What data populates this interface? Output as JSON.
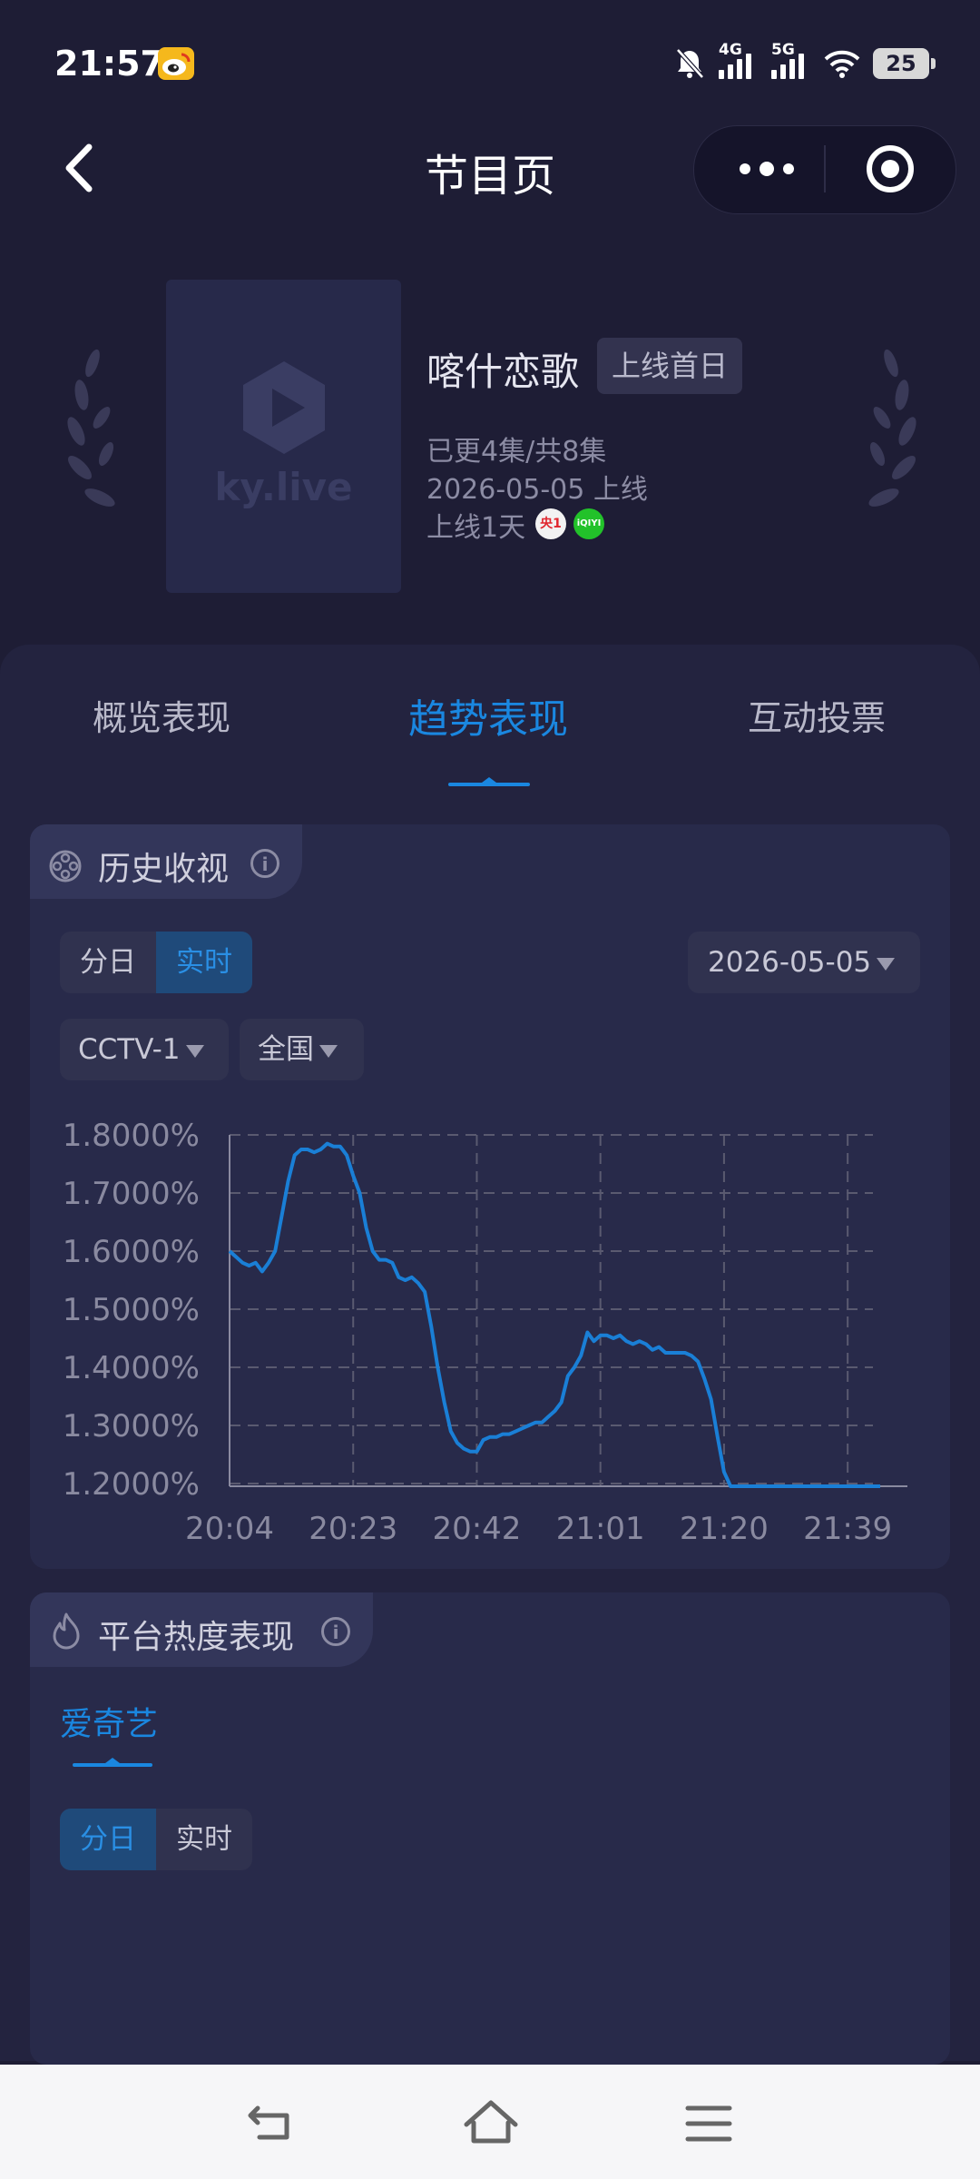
{
  "status_bar": {
    "time": "21:57",
    "battery": "25",
    "network_1": "4G",
    "network_2": "5G"
  },
  "header": {
    "title": "节目页"
  },
  "show": {
    "logo_text": "ky.live",
    "title": "喀什恋歌",
    "badge": "上线首日",
    "episodes": "已更4集/共8集",
    "release": "2026-05-05 上线",
    "days_online": "上线1天",
    "platform_badges": [
      "央1",
      "iQIYI"
    ]
  },
  "tabs": [
    {
      "label": "概览表现",
      "active": false
    },
    {
      "label": "趋势表现",
      "active": true
    },
    {
      "label": "互动投票",
      "active": false
    }
  ],
  "history": {
    "title": "历史收视",
    "segments": [
      "分日",
      "实时"
    ],
    "active_segment": "实时",
    "date": "2026-05-05",
    "channel": "CCTV-1",
    "region": "全国"
  },
  "chart_data": {
    "type": "line",
    "title": "",
    "xlabel": "",
    "ylabel": "",
    "x_ticks": [
      "20:04",
      "20:23",
      "20:42",
      "21:01",
      "21:20",
      "21:39"
    ],
    "y_ticks": [
      "1.8000%",
      "1.7000%",
      "1.6000%",
      "1.5000%",
      "1.4000%",
      "1.3000%",
      "1.2000%"
    ],
    "ylim": [
      1.155,
      1.8
    ],
    "x_range_minutes_from_2004": [
      0,
      100
    ],
    "grid": true,
    "color": "#1a7fd6",
    "series": [
      {
        "x": [
          0,
          1,
          2,
          3,
          4,
          5,
          6,
          7,
          8,
          9,
          10,
          11,
          12,
          13,
          14,
          15,
          16,
          17,
          18,
          19,
          20,
          21,
          22,
          23,
          24,
          25,
          26,
          27,
          28,
          29,
          30,
          31,
          32,
          33,
          34,
          35,
          36,
          37,
          38,
          39,
          40,
          41,
          42,
          43,
          44,
          45,
          46,
          47,
          48,
          49,
          50,
          51,
          52,
          53,
          54,
          55,
          56,
          57,
          58,
          59,
          60,
          61,
          62,
          63,
          64,
          65,
          66,
          67,
          68,
          69,
          70,
          71,
          72,
          73,
          74,
          75,
          76,
          77,
          78,
          79,
          80,
          81,
          82,
          83,
          84,
          85,
          86,
          87,
          88,
          89,
          90,
          91,
          92,
          93,
          94,
          95,
          96,
          97,
          98,
          99,
          100
        ],
        "y": [
          1.6,
          1.59,
          1.58,
          1.575,
          1.58,
          1.565,
          1.58,
          1.6,
          1.66,
          1.72,
          1.765,
          1.775,
          1.775,
          1.77,
          1.775,
          1.785,
          1.78,
          1.78,
          1.765,
          1.73,
          1.7,
          1.64,
          1.6,
          1.585,
          1.585,
          1.58,
          1.555,
          1.55,
          1.555,
          1.545,
          1.53,
          1.47,
          1.4,
          1.34,
          1.29,
          1.27,
          1.26,
          1.255,
          1.255,
          1.275,
          1.28,
          1.28,
          1.285,
          1.285,
          1.29,
          1.295,
          1.3,
          1.305,
          1.305,
          1.315,
          1.325,
          1.34,
          1.385,
          1.4,
          1.42,
          1.46,
          1.445,
          1.455,
          1.455,
          1.45,
          1.455,
          1.445,
          1.44,
          1.445,
          1.44,
          1.43,
          1.435,
          1.425,
          1.425,
          1.425,
          1.425,
          1.42,
          1.41,
          1.38,
          1.345,
          1.28,
          1.22,
          1.18,
          1.16,
          1.155,
          1.155,
          1.155,
          1.155,
          1.155,
          1.155,
          1.155,
          1.155,
          1.155,
          1.155,
          1.155,
          1.155,
          1.155,
          1.155,
          1.155,
          1.155,
          1.155,
          1.155,
          1.155,
          1.155,
          1.155,
          1.155
        ]
      }
    ]
  },
  "platform": {
    "title": "平台热度表现",
    "tab": "爱奇艺",
    "segments": [
      "分日",
      "实时"
    ],
    "active_segment": "分日"
  },
  "colors": {
    "accent": "#1a87e0",
    "background": "#1e1d35",
    "card": "#282a4a"
  }
}
